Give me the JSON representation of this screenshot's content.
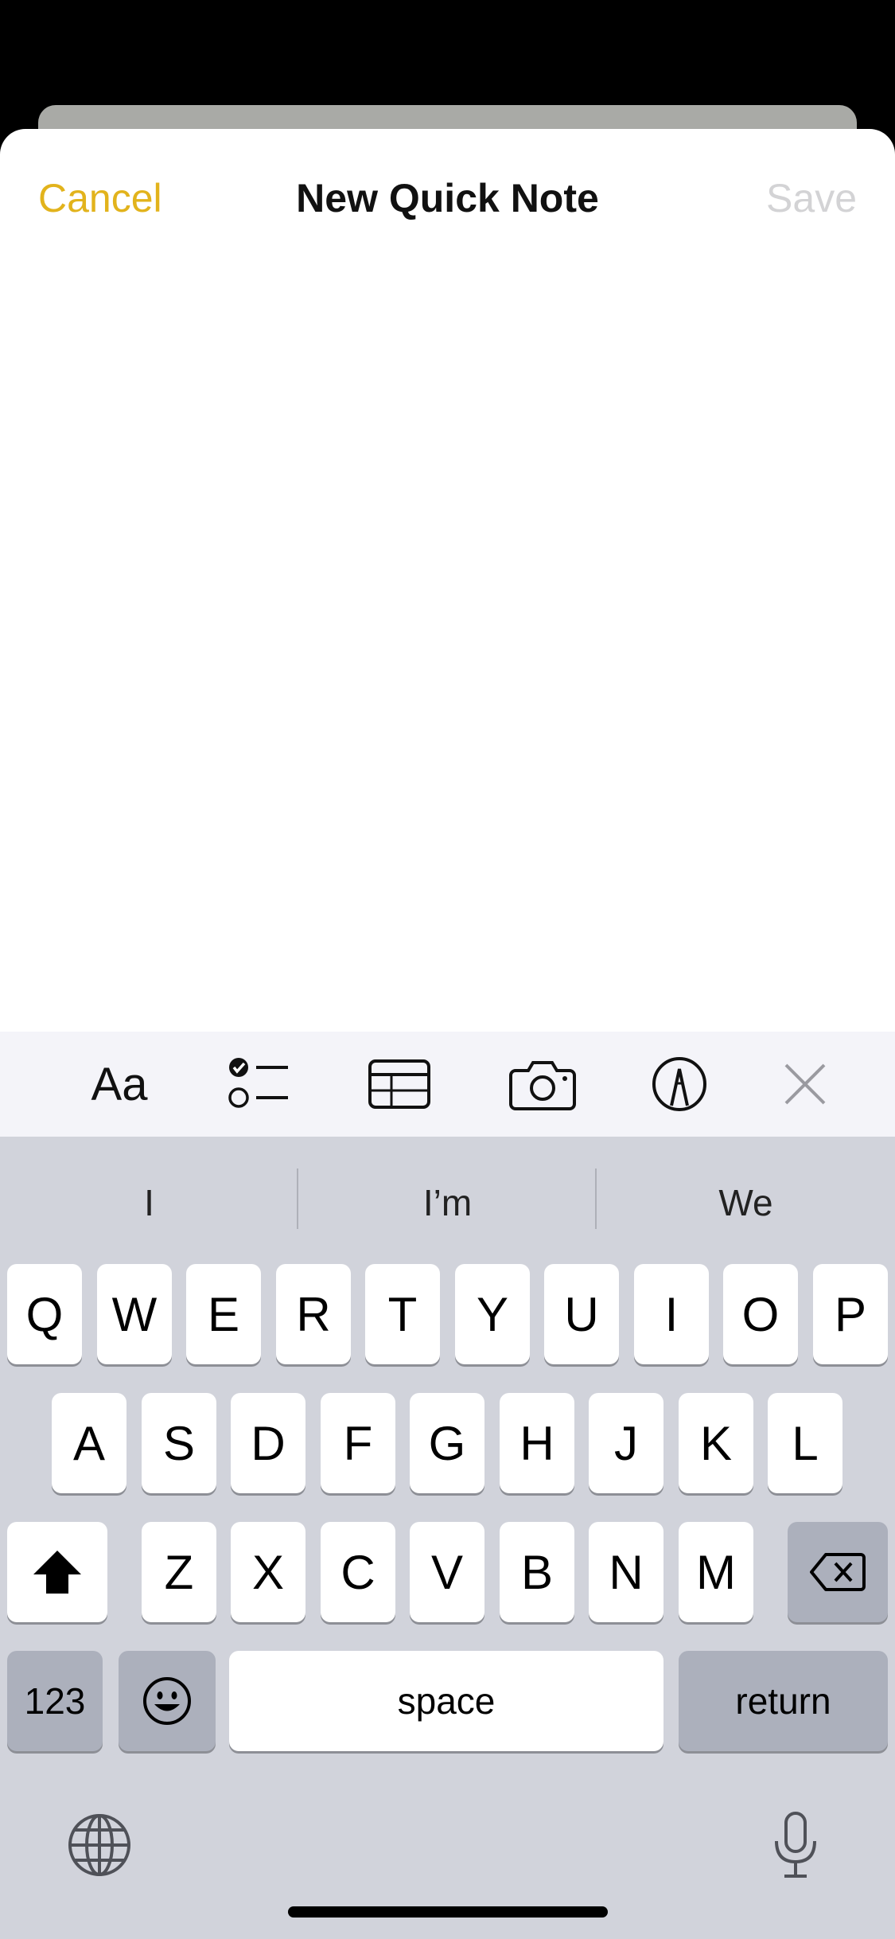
{
  "nav": {
    "cancel": "Cancel",
    "title": "New Quick Note",
    "save": "Save"
  },
  "colors": {
    "accent": "#e2b31c",
    "disabled": "#d3d3d5",
    "keyboard_bg": "#d1d3db",
    "toolbar_bg": "#f4f4f9"
  },
  "toolbar": {
    "format_label": "Aa",
    "icons": [
      "format-text-icon",
      "checklist-icon",
      "table-icon",
      "camera-icon",
      "markup-pen-icon",
      "close-icon"
    ]
  },
  "predictions": [
    "I",
    "I’m",
    "We"
  ],
  "keyboard": {
    "row1": [
      "Q",
      "W",
      "E",
      "R",
      "T",
      "Y",
      "U",
      "I",
      "O",
      "P"
    ],
    "row2": [
      "A",
      "S",
      "D",
      "F",
      "G",
      "H",
      "J",
      "K",
      "L"
    ],
    "row3": [
      "Z",
      "X",
      "C",
      "V",
      "B",
      "N",
      "M"
    ],
    "numbers": "123",
    "space": "space",
    "return": "return",
    "icons": [
      "shift-icon",
      "delete-icon",
      "emoji-icon",
      "globe-icon",
      "microphone-icon"
    ]
  }
}
